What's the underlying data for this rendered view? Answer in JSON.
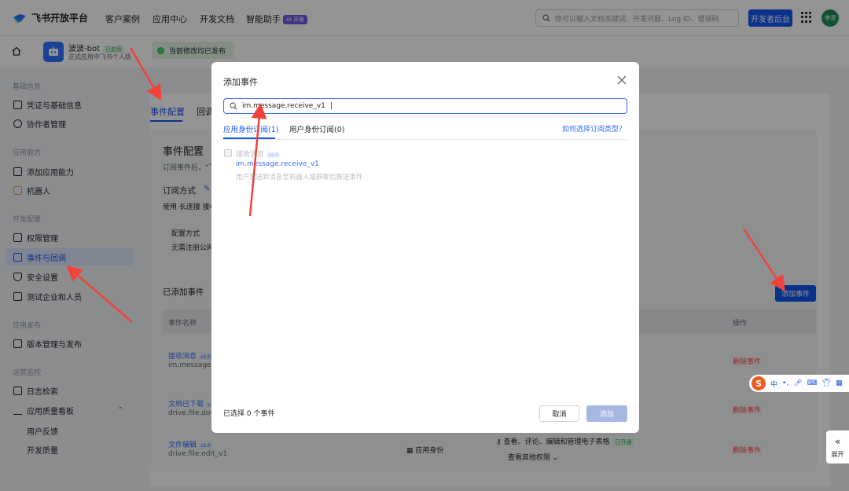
{
  "topnav": {
    "brand": "飞书开放平台",
    "items": [
      "客户案例",
      "应用中心",
      "开发文档",
      "智能助手"
    ],
    "ai_badge": "AI 开发",
    "search_placeholder": "你可以输入文档关键词、开发问题、Log ID、错误码",
    "dev_console": "开发者后台",
    "avatar_text": "李滢"
  },
  "app": {
    "name": "波波-bot",
    "status": "已启用",
    "subtitle": "正式应用中飞书个人版",
    "published": "当前修改均已发布"
  },
  "sidebar": {
    "sections": [
      {
        "title": "基础信息",
        "items": [
          "凭证与基础信息",
          "协作者管理"
        ]
      },
      {
        "title": "应用能力",
        "items": [
          "添加应用能力",
          "机器人"
        ]
      },
      {
        "title": "开发配置",
        "items": [
          "权限管理",
          "事件与回调",
          "安全设置",
          "测试企业和人员"
        ]
      },
      {
        "title": "应用发布",
        "items": [
          "版本管理与发布"
        ]
      },
      {
        "title": "运营监控",
        "items": [
          "日志检索",
          "应用质量看板"
        ]
      }
    ],
    "sub_items": [
      "用户反馈",
      "开发质量"
    ],
    "active": "事件与回调"
  },
  "main": {
    "tabs": [
      "事件配置",
      "回调"
    ],
    "title": "事件配置",
    "desc": "订阅事件后，\"飞",
    "sub_method": "订阅方式",
    "use_text": "使用 长连接 接收",
    "config_label": "配置方式",
    "config_value": "无需注册公网",
    "added_title": "已添加事件",
    "add_btn": "添加事件",
    "col_name": "事件名称",
    "col_op": "操作",
    "rows": [
      {
        "name": "接收消息",
        "tag": "v2.0",
        "id": "im.message.r",
        "op": "删除事件"
      },
      {
        "name": "文档已下载",
        "tag": "v2",
        "id": "drive.file.dow",
        "op": "删除事件"
      },
      {
        "name": "文件编辑",
        "tag": "v2.0",
        "id": "drive.file.edit_v1",
        "identity": "应用身份",
        "perm": "查看、评论、编辑和管理电子表格",
        "perm_tag": "已开通",
        "more": "查看其他权限",
        "op": "删除事件"
      }
    ]
  },
  "modal": {
    "title": "添加事件",
    "search_value": "im.message.receive_v1",
    "tabs": [
      "应用身份订阅(1)",
      "用户身份订阅(0)"
    ],
    "help": "如何选择订阅类型?",
    "event_name": "接收消息",
    "event_tag": "v2.0",
    "event_id": "im.message.receive_v1",
    "event_desc": "用户发送新消息至机器人或群聊后推送事件",
    "selected": "已选择 0 个事件",
    "cancel": "取消",
    "add": "添加"
  },
  "ime": {
    "lang": "中"
  },
  "side_expand": "展开",
  "colors": {
    "accent": "#1456f0",
    "danger": "#f54a45",
    "arrow": "#f0433a"
  }
}
